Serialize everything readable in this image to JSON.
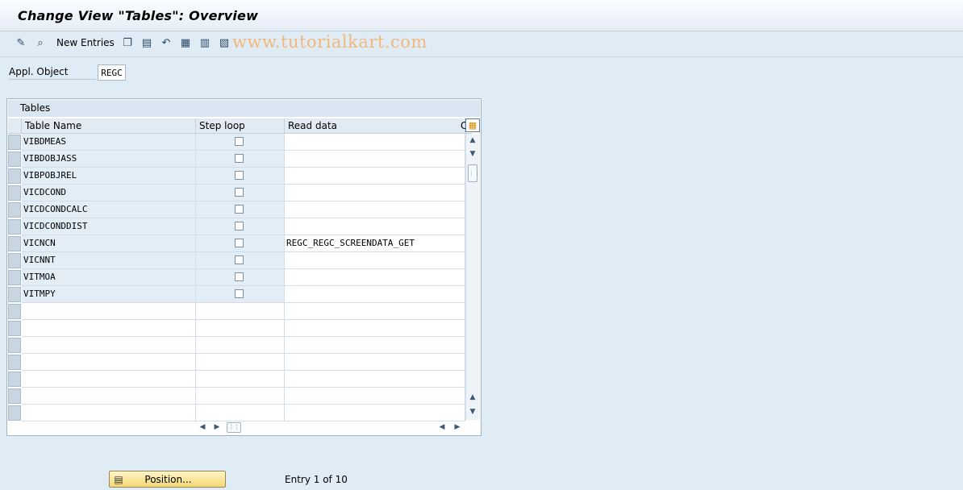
{
  "window": {
    "title": "Change View \"Tables\": Overview"
  },
  "toolbar": {
    "icons": [
      "edit-glasses-icon",
      "find-icon",
      "copy-icon",
      "delete-icon",
      "undo-icon",
      "select-all-icon",
      "select-block-icon",
      "deselect-all-icon"
    ],
    "new_entries_label": "New Entries"
  },
  "watermark": "www.tutorialkart.com",
  "appl_object": {
    "label": "Appl. Object",
    "value": "REGC"
  },
  "tables_panel": {
    "title": "Tables",
    "columns": [
      "Table Name",
      "Step loop",
      "Read data",
      "C"
    ],
    "rows": [
      {
        "table_name": "VIBDMEAS",
        "step_loop": false,
        "read_data": ""
      },
      {
        "table_name": "VIBDOBJASS",
        "step_loop": false,
        "read_data": ""
      },
      {
        "table_name": "VIBPOBJREL",
        "step_loop": false,
        "read_data": ""
      },
      {
        "table_name": "VICDCOND",
        "step_loop": false,
        "read_data": ""
      },
      {
        "table_name": "VICDCONDCALC",
        "step_loop": false,
        "read_data": ""
      },
      {
        "table_name": "VICDCONDDIST",
        "step_loop": false,
        "read_data": ""
      },
      {
        "table_name": "VICNCN",
        "step_loop": false,
        "read_data": "REGC_REGC_SCREENDATA_GET"
      },
      {
        "table_name": "VICNNT",
        "step_loop": false,
        "read_data": ""
      },
      {
        "table_name": "VITMOA",
        "step_loop": false,
        "read_data": ""
      },
      {
        "table_name": "VITMPY",
        "step_loop": false,
        "read_data": ""
      }
    ],
    "empty_rows": 7
  },
  "footer": {
    "position_button_label": "Position...",
    "entry_info": "Entry 1 of 10"
  }
}
